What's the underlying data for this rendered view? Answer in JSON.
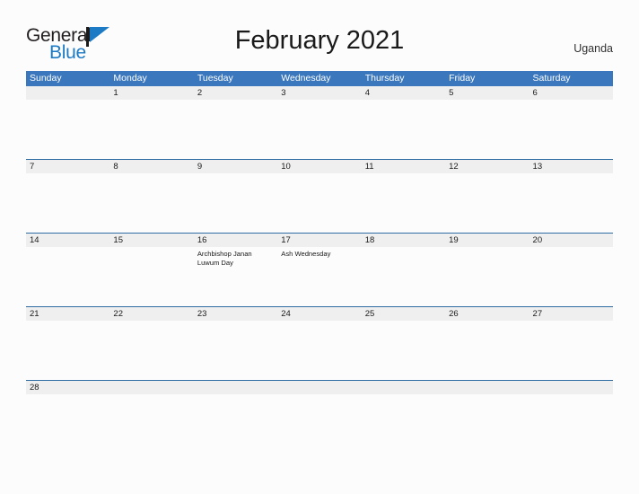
{
  "brand": {
    "name_part1": "General",
    "name_part2": "Blue",
    "flag_icon": "flag-triangle-icon",
    "accent_color": "#1d7ac4"
  },
  "header": {
    "title": "February 2021",
    "region": "Uganda"
  },
  "theme": {
    "header_blue": "#3a77bd",
    "row_divider_blue": "#2e6da4",
    "day_band_gray": "#efefef",
    "page_background": "#fcfcfd",
    "text_color": "#1a1a1a"
  },
  "calendar": {
    "month": "February",
    "year": "2021",
    "weekday_headers": [
      "Sunday",
      "Monday",
      "Tuesday",
      "Wednesday",
      "Thursday",
      "Friday",
      "Saturday"
    ],
    "weeks": [
      [
        {
          "date": ""
        },
        {
          "date": "1"
        },
        {
          "date": "2"
        },
        {
          "date": "3"
        },
        {
          "date": "4"
        },
        {
          "date": "5"
        },
        {
          "date": "6"
        }
      ],
      [
        {
          "date": "7"
        },
        {
          "date": "8"
        },
        {
          "date": "9"
        },
        {
          "date": "10"
        },
        {
          "date": "11"
        },
        {
          "date": "12"
        },
        {
          "date": "13"
        }
      ],
      [
        {
          "date": "14"
        },
        {
          "date": "15"
        },
        {
          "date": "16",
          "events": [
            "Archbishop Janan Luwum Day"
          ]
        },
        {
          "date": "17",
          "events": [
            "Ash Wednesday"
          ]
        },
        {
          "date": "18"
        },
        {
          "date": "19"
        },
        {
          "date": "20"
        }
      ],
      [
        {
          "date": "21"
        },
        {
          "date": "22"
        },
        {
          "date": "23"
        },
        {
          "date": "24"
        },
        {
          "date": "25"
        },
        {
          "date": "26"
        },
        {
          "date": "27"
        }
      ],
      [
        {
          "date": "28"
        },
        {
          "date": ""
        },
        {
          "date": ""
        },
        {
          "date": ""
        },
        {
          "date": ""
        },
        {
          "date": ""
        },
        {
          "date": ""
        }
      ]
    ]
  }
}
